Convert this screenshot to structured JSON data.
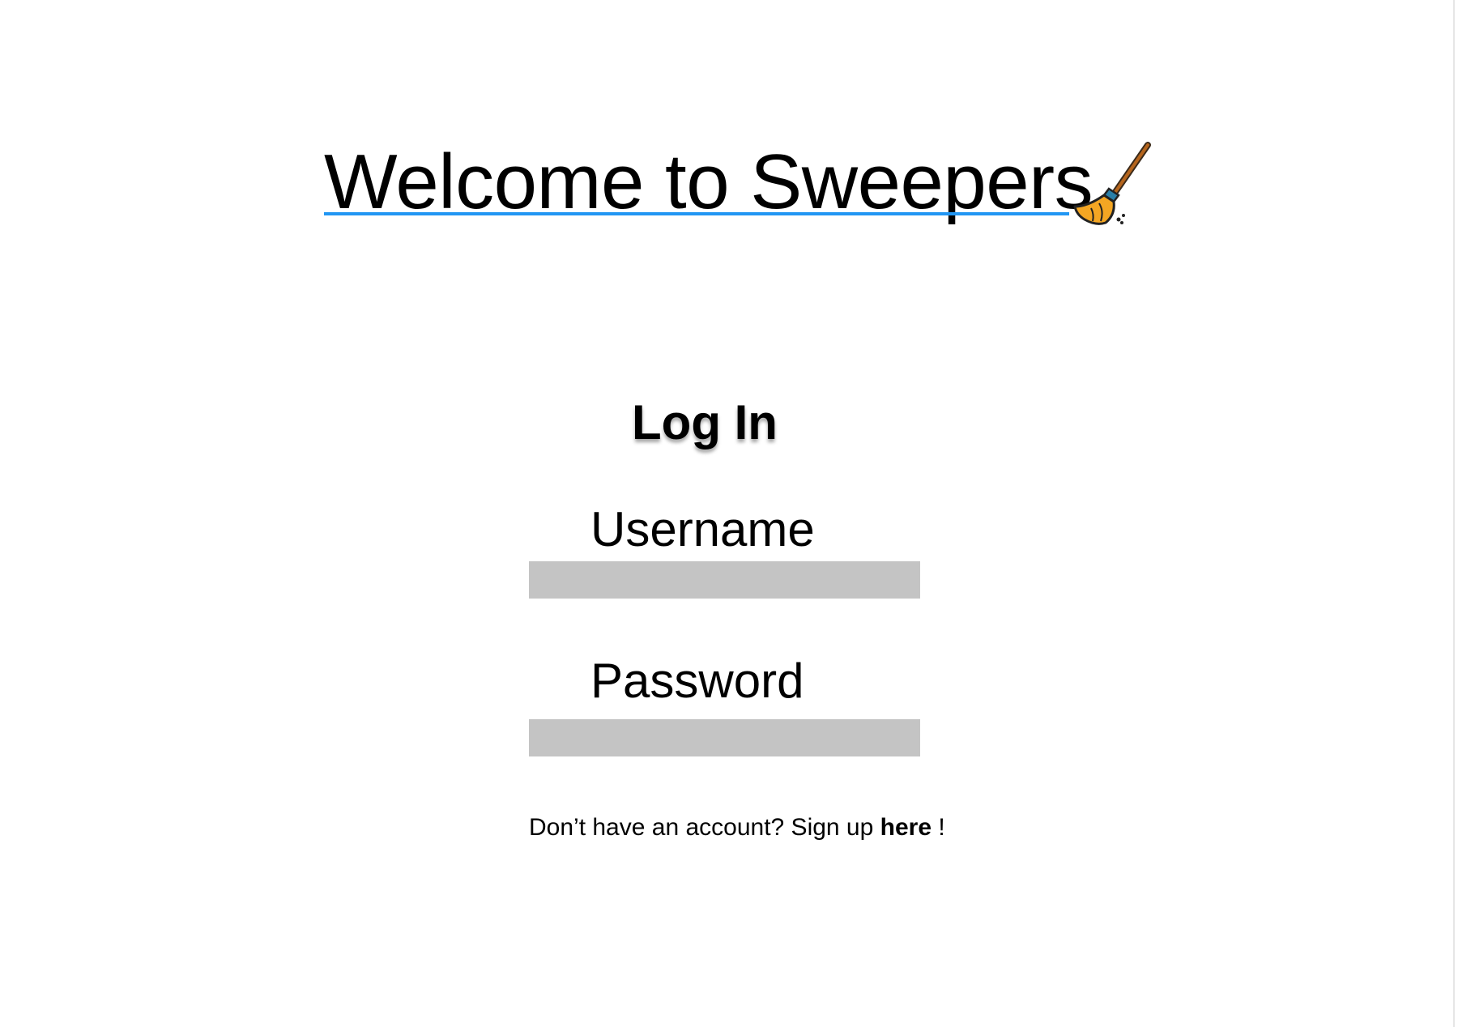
{
  "header": {
    "title": "Welcome to Sweepers",
    "icon": "broom-icon",
    "underline_color": "#2196f3"
  },
  "login": {
    "heading": "Log In",
    "username_label": "Username",
    "username_value": "",
    "password_label": "Password",
    "password_value": "",
    "input_background": "#c4c4c4"
  },
  "signup": {
    "prompt": "Don’t have an account? Sign up",
    "link_label": "here",
    "suffix": "!"
  }
}
